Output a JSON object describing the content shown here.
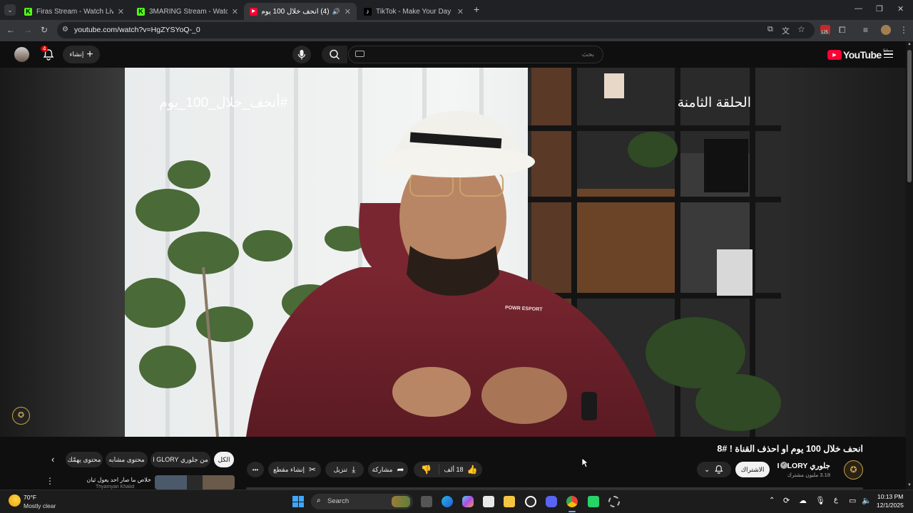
{
  "browser": {
    "tabs": [
      {
        "title": "Firas Stream - Watch Live on Ki",
        "favicon": "kick-icon",
        "color": "#53fc18",
        "glyph": "K"
      },
      {
        "title": "3MARING Stream - Watch Live",
        "favicon": "kick-icon",
        "color": "#53fc18",
        "glyph": "K"
      },
      {
        "title": "(4) انحف خلال 100 يوم او اح",
        "favicon": "youtube-icon",
        "color": "#ff0033",
        "glyph": "▶"
      },
      {
        "title": "TikTok - Make Your Day",
        "favicon": "tiktok-icon",
        "color": "#ffffff",
        "glyph": "♪"
      }
    ],
    "url": "youtube.com/watch?v=HgZYSYoQ-_0",
    "extension_badge": "125"
  },
  "youtube": {
    "logo_text": "YouTube",
    "region": "SA",
    "search_placeholder": "بحث",
    "create_label": "إنشاء",
    "notification_count": "4"
  },
  "video": {
    "overlay_hashtag": "#أنحف_خلال_100_يوم",
    "overlay_episode": "الحلقة الثامنة",
    "hoodie_text": "POWR ESPORT",
    "title": "انحف خلال 100 يوم او احذف القناة ! #8",
    "channel_name": "جلوري I GLORY",
    "subscribers": "3.18 مليون مشترك",
    "subscribe_label": "الاشتراك",
    "likes": "18 ألف",
    "share_label": "مشاركة",
    "download_label": "تنزيل",
    "clip_label": "إنشاء مقطع",
    "more_label": "•••"
  },
  "chips": [
    {
      "label": "الكل",
      "active": true
    },
    {
      "label": "من جلوري I GLORY",
      "active": false
    },
    {
      "label": "محتوى مشابه",
      "active": false
    },
    {
      "label": "محتوى يهمّك",
      "active": false
    }
  ],
  "recommendation": {
    "title": "خلاص ما صار احد يعول ثيان",
    "channel": "Thyamyan Khalid"
  },
  "taskbar": {
    "weather_temp": "70°F",
    "weather_desc": "Mostly clear",
    "search_label": "Search",
    "time": "10:13 PM",
    "date": "12/1/2025",
    "lang": "ع"
  }
}
